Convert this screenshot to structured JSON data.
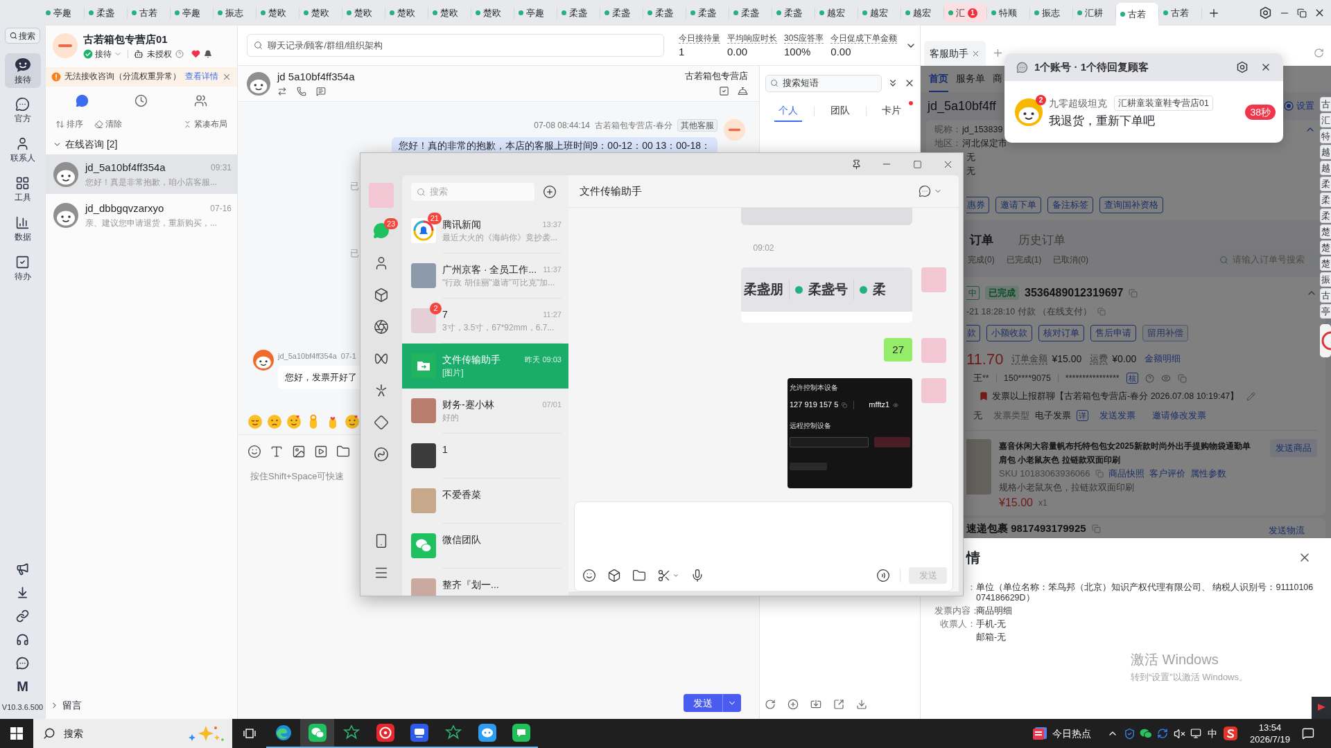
{
  "tab_bar": {
    "tabs": [
      {
        "label": "亭趣",
        "selected": false
      },
      {
        "label": "柔盏",
        "selected": false
      },
      {
        "label": "古若",
        "selected": false
      },
      {
        "label": "亭趣",
        "selected": false
      },
      {
        "label": "振志",
        "selected": false
      },
      {
        "label": "楚欧",
        "selected": false
      },
      {
        "label": "楚欧",
        "selected": false
      },
      {
        "label": "楚欧",
        "selected": false
      },
      {
        "label": "楚欧",
        "selected": false
      },
      {
        "label": "楚欧",
        "selected": false
      },
      {
        "label": "楚欧",
        "selected": false
      },
      {
        "label": "亭趣",
        "selected": false
      },
      {
        "label": "柔盏",
        "selected": false
      },
      {
        "label": "柔盏",
        "selected": false
      },
      {
        "label": "柔盏",
        "selected": false
      },
      {
        "label": "柔盏",
        "selected": false
      },
      {
        "label": "柔盏",
        "selected": false
      },
      {
        "label": "柔盏",
        "selected": false
      },
      {
        "label": "越宏",
        "selected": false
      },
      {
        "label": "越宏",
        "selected": false
      },
      {
        "label": "越宏",
        "selected": false
      },
      {
        "label": "汇",
        "selected": false,
        "badge": "1"
      },
      {
        "label": "特顺",
        "selected": false
      },
      {
        "label": "振志",
        "selected": false
      },
      {
        "label": "汇耕",
        "selected": false
      },
      {
        "label": "古若",
        "selected": true
      },
      {
        "label": "古若",
        "selected": false
      }
    ]
  },
  "sidebar": {
    "search": "搜索",
    "items": [
      {
        "label": "接待",
        "selected": true
      },
      {
        "label": "官方",
        "selected": false
      },
      {
        "label": "联系人",
        "selected": false
      },
      {
        "label": "工具",
        "selected": false
      },
      {
        "label": "数据",
        "selected": false
      },
      {
        "label": "待办",
        "selected": false
      }
    ],
    "app_letter": "M",
    "version": "V10.3.6.500"
  },
  "account": {
    "name": "古若箱包专营店01",
    "status": "接待",
    "permission": "未授权"
  },
  "notice": {
    "text": "无法接收咨询（分流权重异常）",
    "link": "查看详情"
  },
  "list_tabs": [
    {
      "selected": true
    },
    {
      "selected": false
    },
    {
      "selected": false
    }
  ],
  "list_actions": [
    "排序",
    "清除",
    "紧凑布局"
  ],
  "online_group": {
    "label": "在线咨询 [2]",
    "expanded": true,
    "conversations": [
      {
        "name": "jd_5a10bf4ff354a",
        "time": "09:31",
        "preview": "您好！真是非常抱歉，咱小店客服...",
        "selected": true
      },
      {
        "name": "jd_dbbgqvzarxyo",
        "time": "07-16",
        "preview": "亲、建议您申请退货，重新购买，...",
        "selected": false
      }
    ]
  },
  "message_group": {
    "label": "留言",
    "expanded": false
  },
  "header": {
    "search_placeholder": "聊天记录/顾客/群组/组织架构",
    "stats": [
      {
        "label": "今日接待量",
        "value": "1"
      },
      {
        "label": "平均响应时长",
        "value": "0.00"
      },
      {
        "label": "30S应答率",
        "value": "100%"
      },
      {
        "label": "今日促成下单金额",
        "value": "0.00"
      }
    ]
  },
  "chat": {
    "contact": "jd 5a10bf4ff354a",
    "shop": "古若箱包专营店",
    "messages": [
      {
        "kind": "outgoing",
        "time": "07-08 08:44:14",
        "sender": "古若箱包专营店-春分",
        "tag": "其他客服",
        "text": "您好！真的非常的抱歉，本店的客服上班时间9：00-12：00  13：00-18："
      },
      {
        "kind": "status",
        "text": "已"
      },
      {
        "kind": "status",
        "text": "已"
      },
      {
        "kind": "incoming",
        "sender": "jd_5a10bf4ff354a",
        "time": "07-1",
        "text": "您好，发票开好了"
      }
    ],
    "input_placeholder": "按住Shift+Space可快速",
    "send": "发送"
  },
  "phrases": {
    "search_placeholder": "搜索短语",
    "tabs": [
      {
        "label": "个人",
        "selected": true,
        "unread": false
      },
      {
        "label": "团队",
        "selected": false,
        "unread": false
      },
      {
        "label": "卡片",
        "selected": false,
        "unread": true
      }
    ]
  },
  "assistant": {
    "tab": "客服助手",
    "nav": [
      {
        "label": "首页",
        "selected": true
      },
      {
        "label": "服务单",
        "selected": false
      },
      {
        "label": "商",
        "selected": false
      }
    ],
    "customer": "jd_5a10bf4ff",
    "setting": "设置",
    "info": [
      {
        "label": "昵称：",
        "value": "jd_153839"
      },
      {
        "label": "地区：",
        "value": "河北保定市"
      },
      {
        "value": "无"
      },
      {
        "value": "无"
      }
    ],
    "actions": [
      "惠券",
      "邀请下单",
      "备注标签",
      "查询国补资格"
    ],
    "order_tabs": [
      {
        "label": "订单",
        "selected": true
      },
      {
        "label": "历史订单",
        "selected": false
      }
    ],
    "filters": [
      "完成(0)",
      "已完成(1)",
      "已取消(0)"
    ],
    "order_search_placeholder": "请输入订单号搜索",
    "order": {
      "tag": "中",
      "status": "已完成",
      "number": "3536489012319697",
      "paid": "-21 18:28:10 付款 （在线支付）",
      "actions": [
        {
          "label": "款",
          "disabled": false
        },
        {
          "label": "小额收款",
          "disabled": false
        },
        {
          "label": "核对订单",
          "disabled": false
        },
        {
          "label": "售后申请",
          "disabled": false
        },
        {
          "label": "留用补偿",
          "disabled": true
        }
      ],
      "total": "11.70",
      "amount_label": "订单金额",
      "amount": "¥15.00",
      "shipping_label": "运费",
      "shipping": "¥0.00",
      "amount_link": "金额明细",
      "buyer": "王**",
      "phone": "150****9075",
      "address": "****************",
      "verify": "核",
      "note": "发票以上报群聊【古若箱包专营店-春分 2026.07.08 10:19:47】",
      "invoice_value": "无",
      "invoice_type_label": "发票类型",
      "invoice_type": "电子发票",
      "invoice_detail": "详",
      "invoice_send": "发送发票",
      "invoice_modify": "邀请修改发票",
      "product": {
        "title": "嘉音休闲大容量帆布托特包包女2025新款时尚外出手提购物袋通勤单肩包 小老鼠灰色 拉链款双面印刷",
        "send": "发送商品",
        "sku": "SKU 10183063936066",
        "links": [
          "商品快照",
          "客户评价",
          "属性参数"
        ],
        "spec": "规格小老鼠灰色，拉链款双面印刷",
        "price": "¥15.00",
        "quantity": "x1"
      }
    },
    "shipment": {
      "text": "速递包裹 9817493179925",
      "link": "发送物流"
    }
  },
  "side_tabs": [
    "古",
    "汇",
    "特",
    "越",
    "越",
    "柔",
    "柔",
    "柔",
    "楚",
    "楚",
    "楚",
    "振",
    "古",
    "亭"
  ],
  "invoice_drawer": {
    "title": "情",
    "rows": [
      {
        "label": "：",
        "value": "单位（单位名称：笨鸟邦（北京）知识产权代理有限公司、 纳税人识别号：91110106074186629D）"
      },
      {
        "label": "发票内容：",
        "value": "商品明细"
      },
      {
        "label": "收票人：",
        "value": "手机-无"
      },
      {
        "value": "邮箱-无"
      }
    ]
  },
  "activation": {
    "title": "激活 Windows",
    "hint": "转到“设置”以激活 Windows。"
  },
  "notification": {
    "title": "1个账号 · 1个待回复顾客",
    "customer": "九零超级坦克",
    "badge": "2",
    "shop": "汇耕童装童鞋专营店01",
    "message": "我退货，重新下单吧",
    "wait": "38秒"
  },
  "wechat": {
    "nav_badge": "23",
    "search_placeholder": "搜索",
    "chats": [
      {
        "name": "腾讯新闻",
        "time": "13:37",
        "preview": "最近大火的《海屿你》竟抄袭...",
        "badge": "21",
        "selected": false,
        "kind": "news"
      },
      {
        "name": "广州京客 · 全员工作...",
        "time": "11:37",
        "preview": "\"行政 胡佳丽\"邀请\"可比克\"加...",
        "selected": false,
        "kind": "photo"
      },
      {
        "name": "7",
        "time": "11:27",
        "preview": "3寸，3.5寸，67*92mm，6.7...",
        "badge": "2",
        "selected": false,
        "kind": "photo"
      },
      {
        "name": "文件传输助手",
        "time": "昨天 09:03",
        "preview": "[图片]",
        "selected": true,
        "kind": "file"
      },
      {
        "name": "财务-蹇小林",
        "time": "07/01",
        "preview": "好的",
        "selected": false,
        "kind": "photo"
      },
      {
        "name": "1",
        "selected": false,
        "kind": "photo"
      },
      {
        "name": "不爱香菜",
        "selected": false,
        "kind": "photo"
      },
      {
        "name": "微信团队",
        "selected": false,
        "kind": "wechat"
      },
      {
        "name": "整齐『划一...",
        "selected": false,
        "kind": "photo"
      }
    ],
    "title": "文件传输助手",
    "messages": [
      {
        "kind": "image"
      },
      {
        "kind": "time",
        "text": "09:02"
      },
      {
        "kind": "tab_image",
        "labels": [
          "柔盏朋",
          "柔盏号",
          "柔"
        ]
      },
      {
        "kind": "text",
        "text": "27"
      },
      {
        "kind": "remote_image",
        "title": "允许控制本设备",
        "device_id": "127 919 157 5",
        "code": "mfftz1",
        "section": "远程控制设备"
      }
    ],
    "send": {
      "label": "发送",
      "disabled": true
    }
  },
  "taskbar": {
    "search_placeholder": "搜索",
    "apps": [
      {
        "kind": "taskview",
        "active": false
      },
      {
        "kind": "edge",
        "active": false
      },
      {
        "kind": "wechat",
        "active": true
      },
      {
        "kind": "star",
        "active": false
      },
      {
        "kind": "record",
        "active": false
      },
      {
        "kind": "jingmai",
        "active": false
      },
      {
        "kind": "star",
        "active": false
      },
      {
        "kind": "bot",
        "active": false
      },
      {
        "kind": "message",
        "active": false
      }
    ],
    "news": "今日热点",
    "ime": "中",
    "time": "13:54",
    "date": "2026/7/19"
  }
}
